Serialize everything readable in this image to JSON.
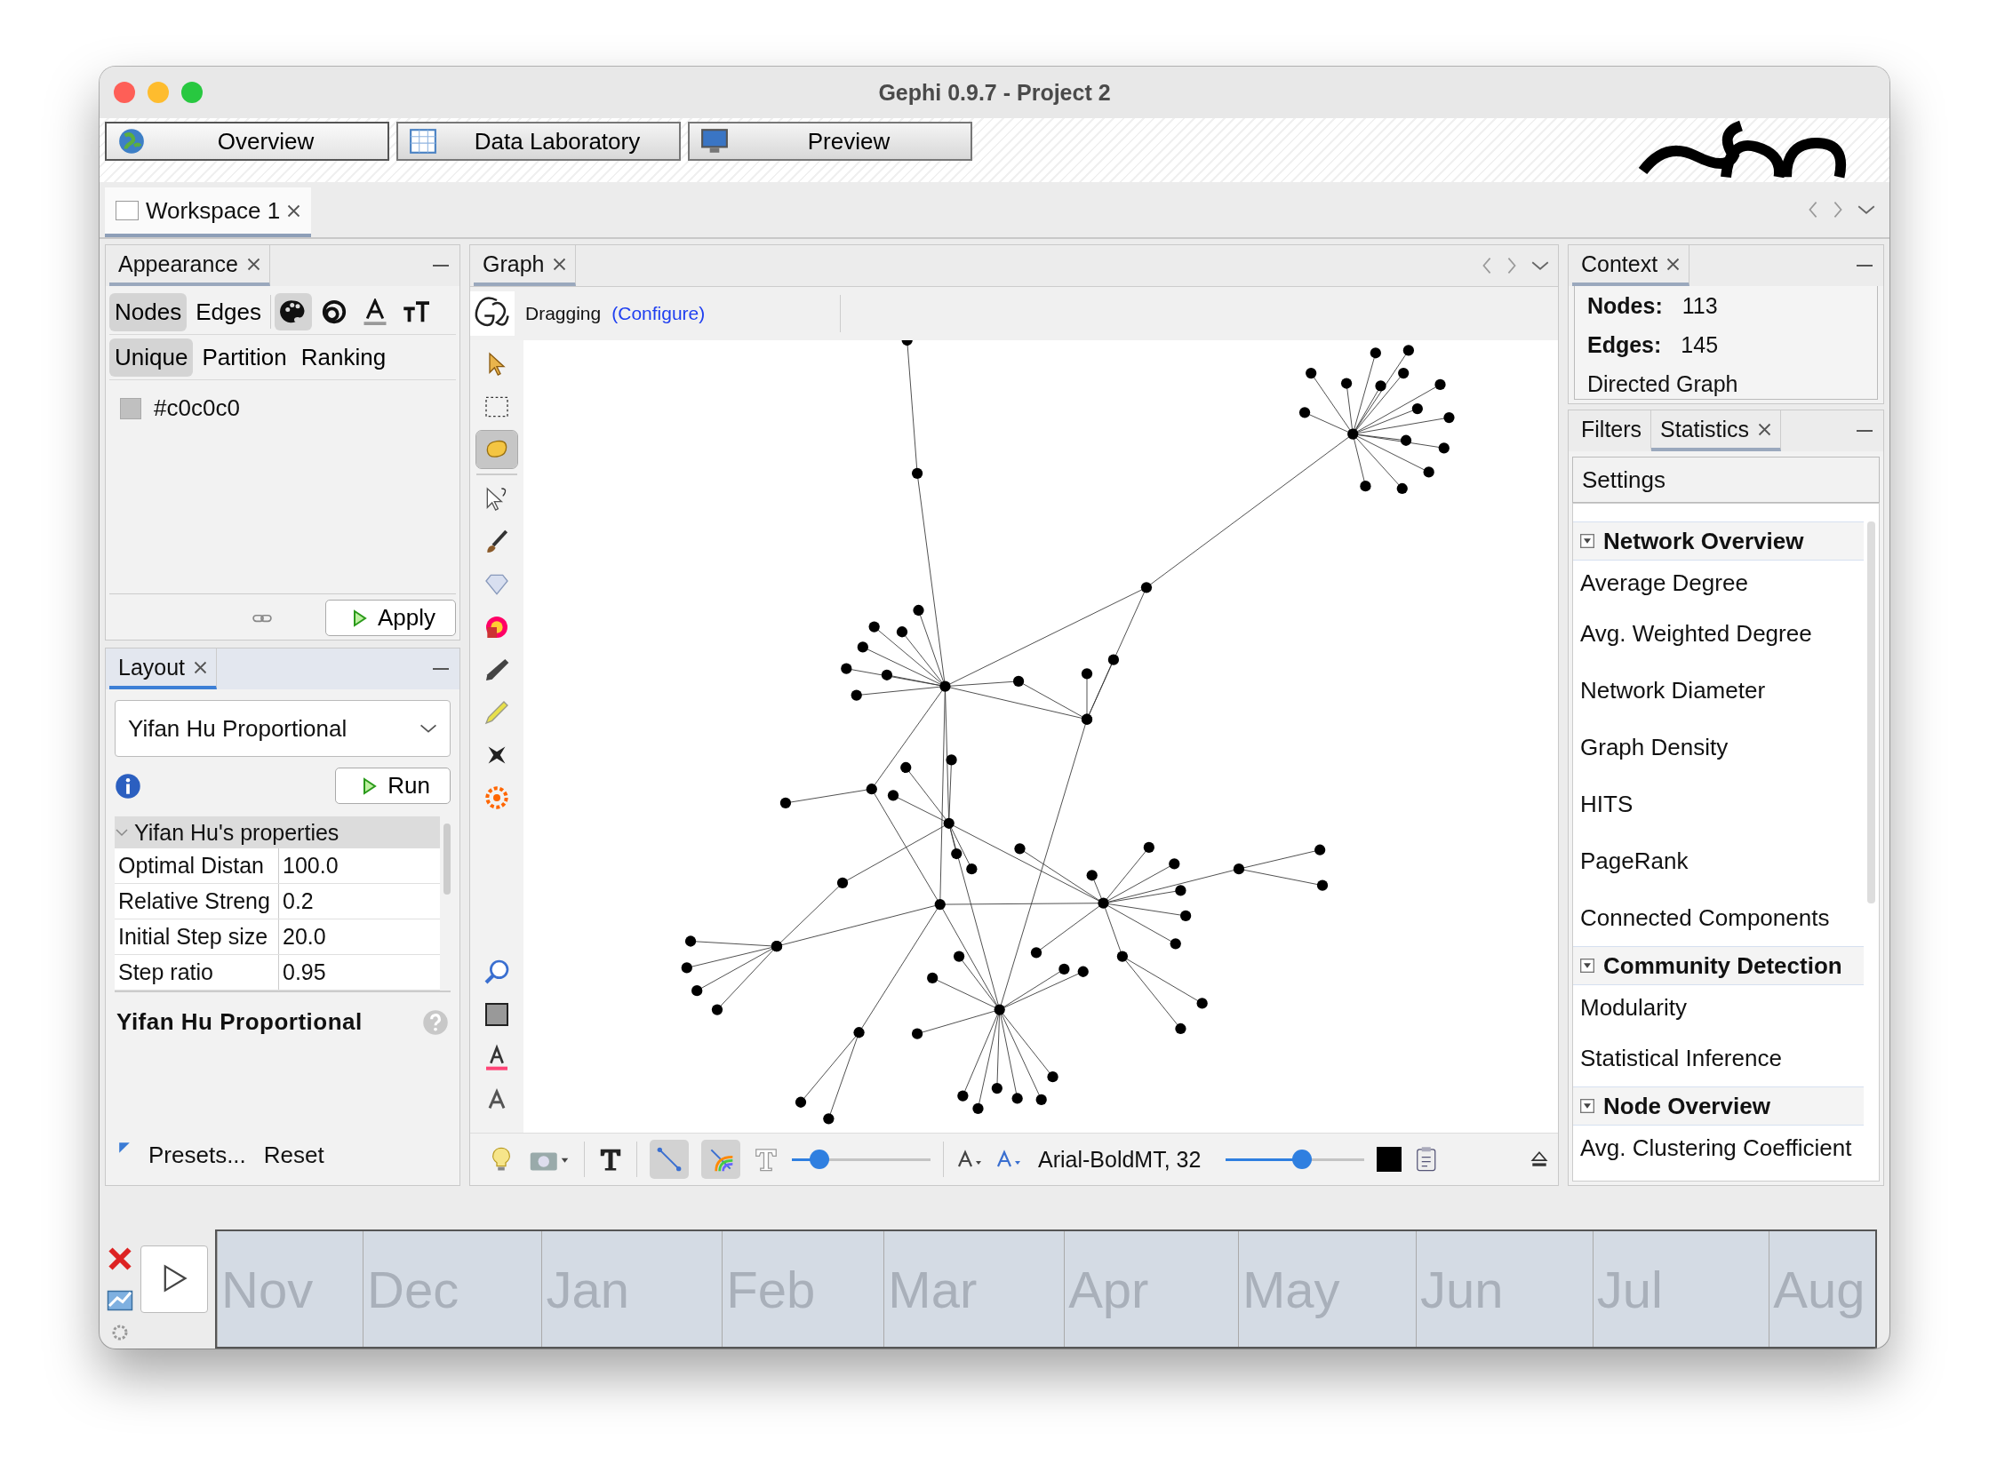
{
  "window": {
    "title": "Gephi 0.9.7 - Project 2"
  },
  "perspectives": [
    {
      "label": "Overview",
      "kind": "globe",
      "selected": true
    },
    {
      "label": "Data Laboratory",
      "kind": "table",
      "selected": false
    },
    {
      "label": "Preview",
      "kind": "monitor",
      "selected": false
    }
  ],
  "workspace_tabs": [
    {
      "label": "Workspace 1",
      "selected": true
    }
  ],
  "appearance": {
    "title": "Appearance",
    "element_tabs": [
      {
        "label": "Nodes",
        "selected": true
      },
      {
        "label": "Edges",
        "selected": false
      }
    ],
    "attribute_tabs": [
      {
        "kind": "color",
        "selected": true
      },
      {
        "kind": "size",
        "selected": false
      },
      {
        "kind": "label-color",
        "selected": false
      },
      {
        "kind": "label-size",
        "selected": false
      }
    ],
    "mode_tabs": [
      {
        "label": "Unique",
        "selected": true
      },
      {
        "label": "Partition",
        "selected": false
      },
      {
        "label": "Ranking",
        "selected": false
      }
    ],
    "swatch": {
      "value": "#c0c0c0",
      "color": "#c0c0c0"
    },
    "apply": "Apply"
  },
  "layout": {
    "title": "Layout",
    "algorithm": "Yifan Hu Proportional",
    "run": "Run",
    "properties_group": {
      "title": "Yifan Hu's properties",
      "expanded": true
    },
    "properties": [
      {
        "name": "Optimal Distan",
        "value": "100.0"
      },
      {
        "name": "Relative Streng",
        "value": "0.2"
      },
      {
        "name": "Initial Step size",
        "value": "20.0"
      },
      {
        "name": "Step ratio",
        "value": "0.95"
      }
    ],
    "description_title": "Yifan Hu Proportional",
    "presets": "Presets...",
    "reset": "Reset"
  },
  "graph": {
    "tab": "Graph",
    "tool_mode": "Dragging",
    "configure": "(Configure)",
    "tools": [
      {
        "kind": "pointer",
        "selected": false
      },
      {
        "kind": "rect-select",
        "selected": false
      },
      {
        "kind": "hand",
        "selected": true
      },
      {
        "kind": "query",
        "selected": false
      },
      {
        "kind": "brush",
        "selected": false
      },
      {
        "kind": "diamond",
        "selected": false
      },
      {
        "kind": "paint",
        "selected": false
      },
      {
        "kind": "pencil",
        "selected": false
      },
      {
        "kind": "marker",
        "selected": false
      },
      {
        "kind": "plane",
        "selected": false
      },
      {
        "kind": "sun",
        "selected": false
      }
    ],
    "bottom_tools": [
      {
        "kind": "zoom-fit"
      },
      {
        "kind": "background"
      },
      {
        "kind": "label-color"
      },
      {
        "kind": "label-font"
      }
    ],
    "show_edges": true,
    "edge_color_by_source": true,
    "edge_weight": {
      "level": 0.2
    },
    "font": "Arial-BoldMT, 32",
    "label_size": {
      "level": 0.55
    }
  },
  "context": {
    "title": "Context",
    "stats": [
      {
        "label": "Nodes:",
        "value": "113"
      },
      {
        "label": "Edges:",
        "value": "145"
      }
    ],
    "graph_type": "Directed Graph"
  },
  "statistics": {
    "tabs": [
      {
        "label": "Filters",
        "selected": false,
        "closable": false
      },
      {
        "label": "Statistics",
        "selected": true,
        "closable": true
      }
    ],
    "settings": "Settings",
    "groups": [
      {
        "title": "Network Overview",
        "expanded": true,
        "items": [
          "Average Degree",
          "Avg. Weighted Degree",
          "Network Diameter",
          "Graph Density",
          "HITS",
          "PageRank",
          "Connected Components"
        ]
      },
      {
        "title": "Community Detection",
        "expanded": true,
        "items": [
          "Modularity",
          "Statistical Inference"
        ]
      },
      {
        "title": "Node Overview",
        "expanded": true,
        "items": [
          "Avg. Clustering Coefficient"
        ]
      }
    ]
  },
  "timeline": {
    "months": [
      {
        "label": "Nov"
      },
      {
        "label": "Dec"
      },
      {
        "label": "Jan"
      },
      {
        "label": "Feb"
      },
      {
        "label": "Mar"
      },
      {
        "label": "Apr"
      },
      {
        "label": "May"
      },
      {
        "label": "Jun"
      },
      {
        "label": "Jul"
      },
      {
        "label": "Aug"
      }
    ]
  }
}
